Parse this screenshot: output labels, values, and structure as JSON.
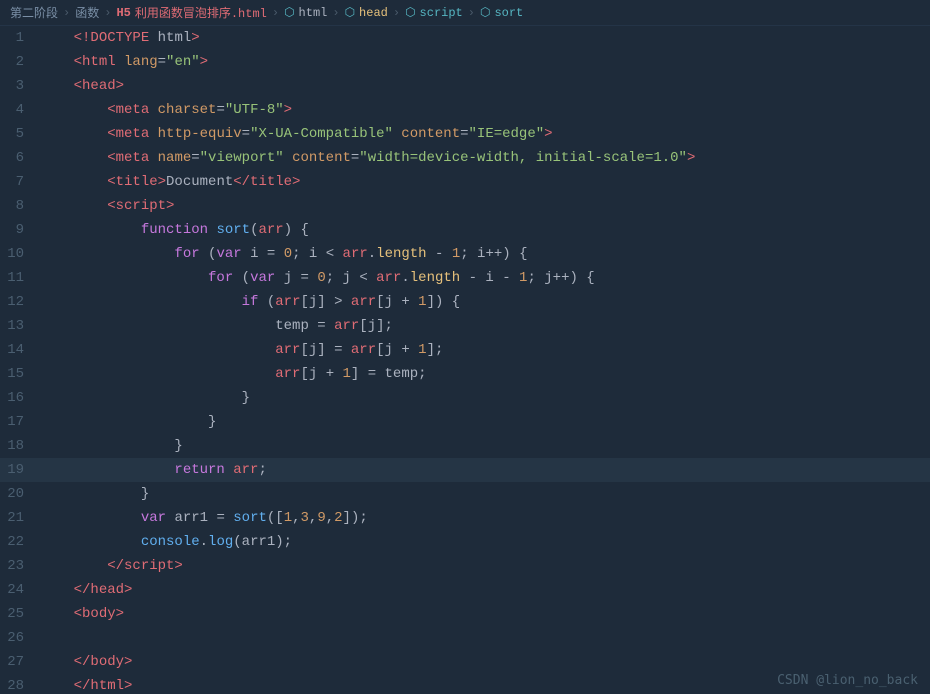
{
  "breadcrumb": {
    "items": [
      {
        "label": "第二阶段",
        "type": "plain"
      },
      {
        "label": ">",
        "type": "sep"
      },
      {
        "label": "函数",
        "type": "plain"
      },
      {
        "label": ">",
        "type": "sep"
      },
      {
        "label": "H5",
        "type": "html-icon"
      },
      {
        "label": "利用函数冒泡排序.html",
        "type": "html"
      },
      {
        "label": ">",
        "type": "sep"
      },
      {
        "label": "html",
        "type": "html-tag"
      },
      {
        "label": ">",
        "type": "sep"
      },
      {
        "label": "head",
        "type": "head-tag"
      },
      {
        "label": ">",
        "type": "sep"
      },
      {
        "label": "script",
        "type": "script-tag"
      },
      {
        "label": ">",
        "type": "sep"
      },
      {
        "label": "sort",
        "type": "sort-tag"
      }
    ]
  },
  "lines": [
    {
      "num": 1,
      "highlighted": false
    },
    {
      "num": 2,
      "highlighted": false
    },
    {
      "num": 3,
      "highlighted": false
    },
    {
      "num": 4,
      "highlighted": false
    },
    {
      "num": 5,
      "highlighted": false
    },
    {
      "num": 6,
      "highlighted": false
    },
    {
      "num": 7,
      "highlighted": false
    },
    {
      "num": 8,
      "highlighted": false
    },
    {
      "num": 9,
      "highlighted": false
    },
    {
      "num": 10,
      "highlighted": false
    },
    {
      "num": 11,
      "highlighted": false
    },
    {
      "num": 12,
      "highlighted": false
    },
    {
      "num": 13,
      "highlighted": false
    },
    {
      "num": 14,
      "highlighted": false
    },
    {
      "num": 15,
      "highlighted": false
    },
    {
      "num": 16,
      "highlighted": false
    },
    {
      "num": 17,
      "highlighted": false
    },
    {
      "num": 18,
      "highlighted": false
    },
    {
      "num": 19,
      "highlighted": true
    },
    {
      "num": 20,
      "highlighted": false
    },
    {
      "num": 21,
      "highlighted": false
    },
    {
      "num": 22,
      "highlighted": false
    },
    {
      "num": 23,
      "highlighted": false
    },
    {
      "num": 24,
      "highlighted": false
    },
    {
      "num": 25,
      "highlighted": false
    },
    {
      "num": 26,
      "highlighted": false
    },
    {
      "num": 27,
      "highlighted": false
    },
    {
      "num": 28,
      "highlighted": false
    }
  ],
  "watermark": {
    "text": "CSDN @lion_no_back"
  }
}
